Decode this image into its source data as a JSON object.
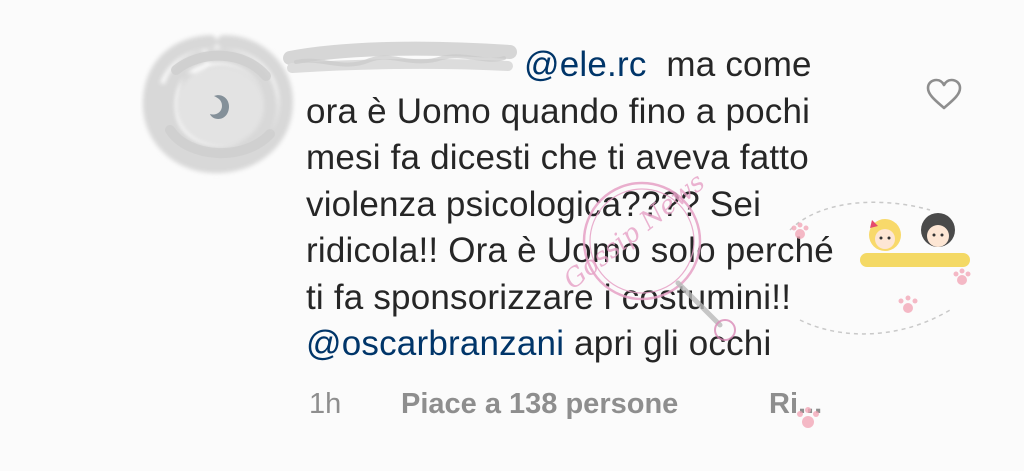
{
  "comment": {
    "mention_1": "@ele.rc",
    "line_1_rest": "  ma come",
    "line_2": "ora è Uomo quando fino a pochi",
    "line_3": "mesi fa dicesti che ti aveva fatto",
    "line_4": "violenza psicologica???? Sei",
    "line_5": "ridicola!! Ora è Uomo solo perché",
    "line_6": "ti fa sponsorizzare i costumini!!",
    "mention_2": "@oscarbranzani",
    "line_7_rest": " apri gli occhi"
  },
  "meta": {
    "time": "1h",
    "likes": "Piace a 138 persone",
    "reply": "Ri..."
  },
  "icons": {
    "like": "heart-outline-icon",
    "avatar": "user-avatar-redacted"
  },
  "watermark": {
    "text": "Gossip News"
  },
  "colors": {
    "text": "#262626",
    "mention": "#003569",
    "meta": "#8e8e8e",
    "background": "#fbfbfb",
    "watermark": "#e6a1c6"
  }
}
